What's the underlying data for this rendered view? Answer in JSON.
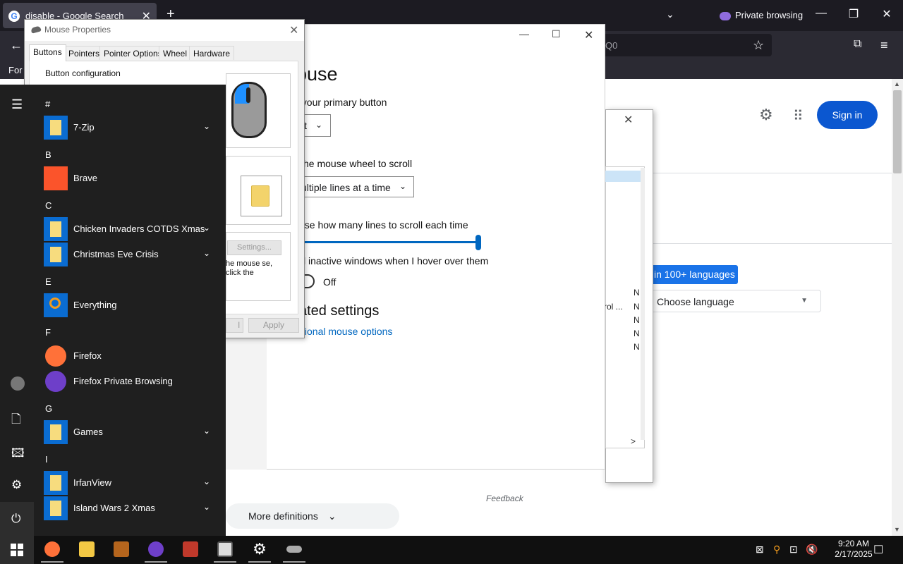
{
  "browser": {
    "tab_title": "disable - Google Search",
    "tab_favicon": "G",
    "new_tab": "+",
    "tab_list": "⌄",
    "private_label": "Private browsing",
    "url_text": "Q0",
    "bookmark_label": "For",
    "win_min": "—",
    "win_max": "❐",
    "win_close": "✕",
    "back": "←",
    "star": "☆",
    "menu": "≡"
  },
  "google": {
    "sign_in": "Sign in",
    "lang_button": "in 100+ languages",
    "choose_language": "Choose language",
    "feedback": "Feedback",
    "more_definitions": "More definitions",
    "accent": "#0b57d0"
  },
  "bg_dialog": {
    "close": "✕",
    "n_marks": [
      "N",
      "N",
      "N",
      "N",
      "N"
    ],
    "ctrl_text": "rol ...",
    "arrow": ">"
  },
  "settings": {
    "title": "ouse",
    "primary_label": "t your primary button",
    "primary_value": "t",
    "wheel_label": "he mouse wheel to scroll",
    "wheel_value": "ultiple lines at a time",
    "lines_label": "ose how many lines to scroll each time",
    "inactive_label": "l inactive windows when I hover over them",
    "toggle_label": "Off",
    "related_title": "ated settings",
    "link": "tional mouse options",
    "min": "—",
    "max": "☐",
    "close": "✕"
  },
  "mouse_props": {
    "title": "Mouse Properties",
    "close": "✕",
    "tabs": [
      "Buttons",
      "Pointers",
      "Pointer Options",
      "Wheel",
      "Hardware"
    ],
    "button_config": "Button configuration",
    "settings_btn": "Settings...",
    "text1": "he mouse se, click the",
    "ok_area": "l",
    "apply": "Apply"
  },
  "start_menu": {
    "letters": [
      "#",
      "B",
      "C",
      "E",
      "F",
      "G",
      "I"
    ],
    "apps": [
      {
        "label": "7-Zip",
        "expand": "⌄"
      },
      {
        "label": "Brave"
      },
      {
        "label": "Chicken Invaders COTDS Xmas",
        "expand": "⌄"
      },
      {
        "label": "Christmas Eve Crisis",
        "expand": "⌄"
      },
      {
        "label": "Everything"
      },
      {
        "label": "Firefox"
      },
      {
        "label": "Firefox Private Browsing"
      },
      {
        "label": "Games",
        "expand": "⌄"
      },
      {
        "label": "IrfanView",
        "expand": "⌄"
      },
      {
        "label": "Island Wars 2 Xmas",
        "expand": "⌄"
      }
    ],
    "rail_menu": "☰",
    "rail_documents": "🗋",
    "rail_pictures": "🖾",
    "rail_settings": "⚙",
    "rail_power": "⏻"
  },
  "taskbar": {
    "time": "9:20 AM",
    "date": "2/17/2025",
    "tray_icons": [
      "⊠",
      "⚲",
      "⊡",
      "🔇"
    ],
    "notif": "☐"
  }
}
